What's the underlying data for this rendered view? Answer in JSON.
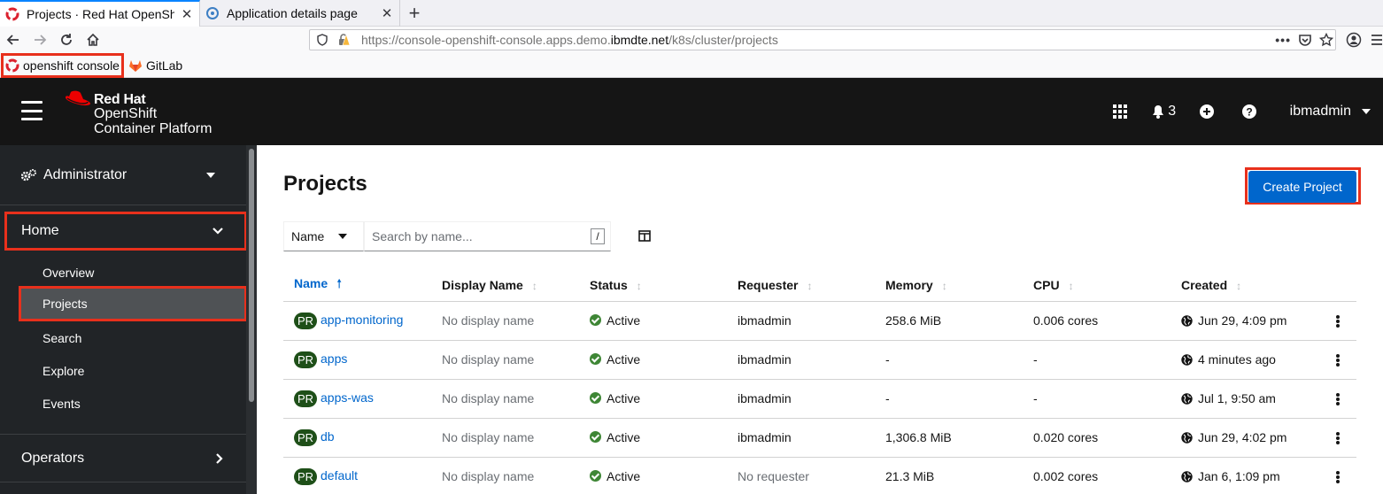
{
  "browser": {
    "tabs": [
      {
        "title": "Projects · Red Hat OpenShift Container Platform",
        "active": true,
        "icon": "openshift-icon"
      },
      {
        "title": "Application details page",
        "active": false,
        "icon": "app-icon"
      }
    ],
    "new_tab_label": "+",
    "url_prefix": "https://console-openshift-console.apps.demo.",
    "url_domain": "ibmdte.net",
    "url_suffix": "/k8s/cluster/projects",
    "bookmarks": [
      {
        "label": "openshift console",
        "icon": "openshift-icon"
      },
      {
        "label": "GitLab",
        "icon": "gitlab-icon"
      }
    ]
  },
  "masthead": {
    "brand_line1": "Red Hat",
    "brand_line2": "OpenShift",
    "brand_line3": "Container Platform",
    "notification_count": "3",
    "username": "ibmadmin"
  },
  "sidebar": {
    "perspective": "Administrator",
    "home_label": "Home",
    "home_items": [
      "Overview",
      "Projects",
      "Search",
      "Explore",
      "Events"
    ],
    "active_item": "Projects",
    "operators_label": "Operators"
  },
  "page": {
    "title": "Projects",
    "create_button": "Create Project",
    "filter_type": "Name",
    "search_placeholder": "Search by name...",
    "search_shortcut": "/"
  },
  "table": {
    "columns": [
      "Name",
      "Display Name",
      "Status",
      "Requester",
      "Memory",
      "CPU",
      "Created"
    ],
    "rows": [
      {
        "badge": "PR",
        "name": "app-monitoring",
        "display_name": "No display name",
        "status": "Active",
        "requester": "ibmadmin",
        "memory": "258.6 MiB",
        "cpu": "0.006 cores",
        "created": "Jun 29, 4:09 pm"
      },
      {
        "badge": "PR",
        "name": "apps",
        "display_name": "No display name",
        "status": "Active",
        "requester": "ibmadmin",
        "memory": "-",
        "cpu": "-",
        "created": "4 minutes ago"
      },
      {
        "badge": "PR",
        "name": "apps-was",
        "display_name": "No display name",
        "status": "Active",
        "requester": "ibmadmin",
        "memory": "-",
        "cpu": "-",
        "created": "Jul 1, 9:50 am"
      },
      {
        "badge": "PR",
        "name": "db",
        "display_name": "No display name",
        "status": "Active",
        "requester": "ibmadmin",
        "memory": "1,306.8 MiB",
        "cpu": "0.020 cores",
        "created": "Jun 29, 4:02 pm"
      },
      {
        "badge": "PR",
        "name": "default",
        "display_name": "No display name",
        "status": "Active",
        "requester": "No requester",
        "memory": "21.3 MiB",
        "cpu": "0.002 cores",
        "created": "Jan 6, 1:09 pm"
      }
    ]
  },
  "colors": {
    "masthead_bg": "#151515",
    "sidebar_bg": "#212427",
    "primary_blue": "#0066cc",
    "highlight_red": "#e8301c",
    "status_green": "#3e8635",
    "badge_green": "#1e4f18"
  }
}
